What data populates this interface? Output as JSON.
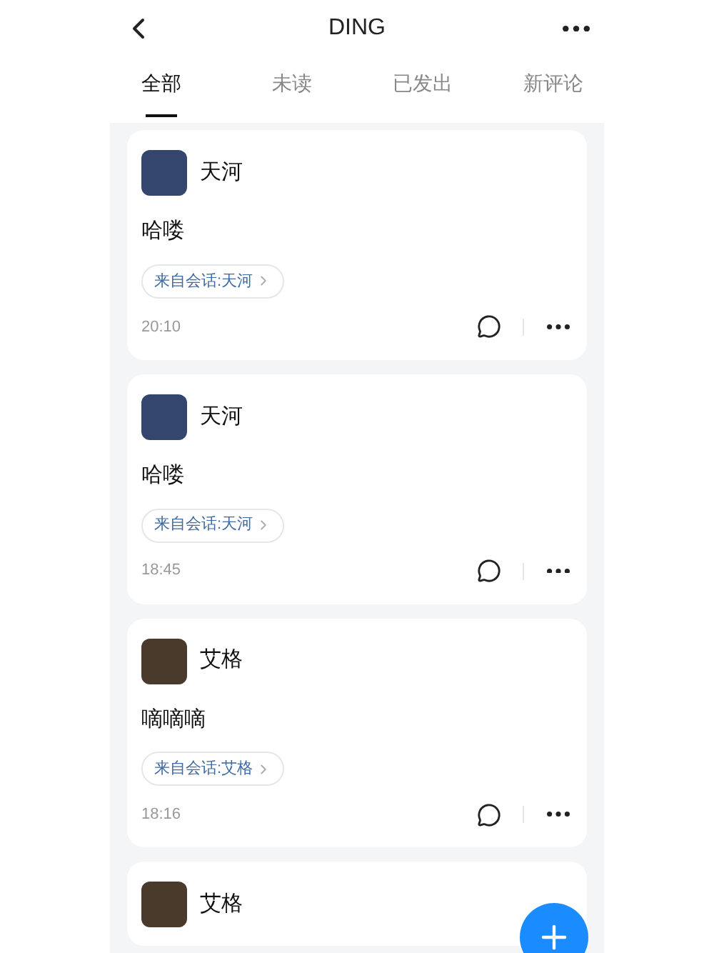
{
  "header": {
    "title": "DING"
  },
  "tabs": [
    {
      "label": "全部",
      "selected": true
    },
    {
      "label": "未读",
      "selected": false
    },
    {
      "label": "已发出",
      "selected": false
    },
    {
      "label": "新评论",
      "selected": false
    }
  ],
  "cards": [
    {
      "name": "天河",
      "message": "哈喽",
      "source": "来自会话:天河",
      "time": "20:10"
    },
    {
      "name": "天河",
      "message": "哈喽",
      "source": "来自会话:天河",
      "time": "18:45"
    },
    {
      "name": "艾格",
      "message": "嘀嘀嘀",
      "source": "来自会话:艾格",
      "time": "18:16"
    },
    {
      "name": "艾格"
    }
  ]
}
